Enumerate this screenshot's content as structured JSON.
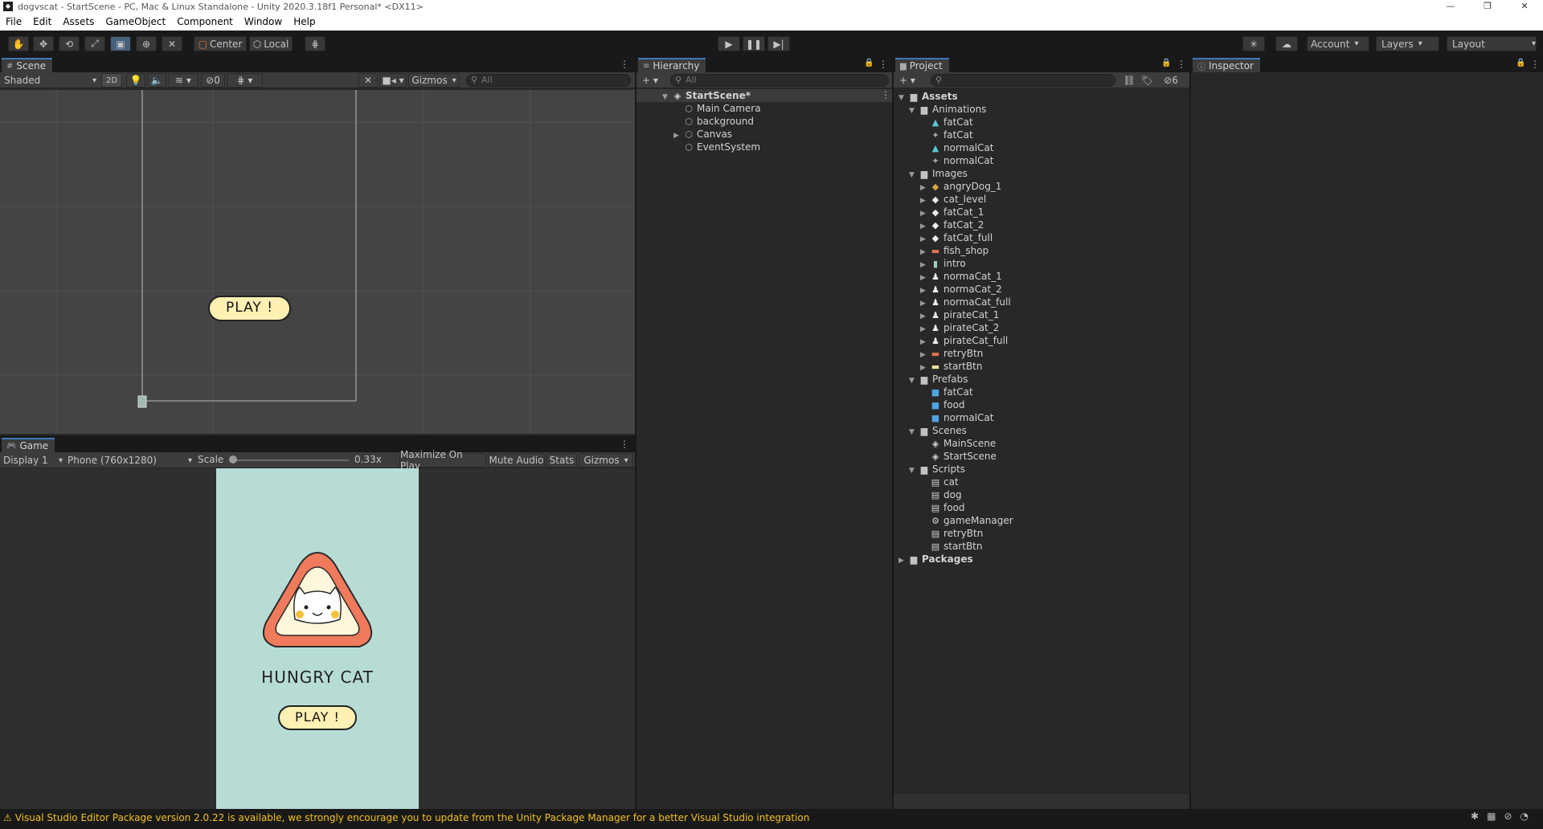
{
  "window": {
    "title": "dogvscat - StartScene - PC, Mac & Linux Standalone - Unity 2020.3.18f1 Personal* <DX11>",
    "controls": [
      "—",
      "❐",
      "✕"
    ]
  },
  "menu": [
    "File",
    "Edit",
    "Assets",
    "GameObject",
    "Component",
    "Window",
    "Help"
  ],
  "toolbar": {
    "pivot": "Center",
    "space": "Local",
    "account": "Account",
    "layers": "Layers",
    "layout": "Layout"
  },
  "scene": {
    "tab": "Scene",
    "shading": "Shaded",
    "mode_2d": "2D",
    "hidden_count": "0",
    "gizmos": "Gizmos",
    "search_placeholder": "All",
    "play_button_label": "PLAY !"
  },
  "game": {
    "tab": "Game",
    "display": "Display 1",
    "resolution": "Phone (760x1280)",
    "scale_label": "Scale",
    "scale_value": "0.33x",
    "scale_fraction": 0.0,
    "maximize": "Maximize On Play",
    "mute": "Mute Audio",
    "stats": "Stats",
    "gizmos": "Gizmos",
    "title": "HUNGRY CAT",
    "play_label": "PLAY !",
    "bg_color": "#b7dcd5"
  },
  "hierarchy": {
    "tab": "Hierarchy",
    "search_placeholder": "All",
    "scene_name": "StartScene*",
    "items": [
      "Main Camera",
      "background",
      "Canvas",
      "EventSystem"
    ]
  },
  "project": {
    "tab": "Project",
    "hidden_count": "6",
    "root": "Assets",
    "folders": {
      "animations": "Animations",
      "images": "Images",
      "prefabs": "Prefabs",
      "scenes": "Scenes",
      "scripts": "Scripts",
      "packages": "Packages"
    },
    "animations": [
      "fatCat",
      "fatCat",
      "normalCat",
      "normalCat"
    ],
    "images": [
      "angryDog_1",
      "cat_level",
      "fatCat_1",
      "fatCat_2",
      "fatCat_full",
      "fish_shop",
      "intro",
      "normaCat_1",
      "normaCat_2",
      "normaCat_full",
      "pirateCat_1",
      "pirateCat_2",
      "pirateCat_full",
      "retryBtn",
      "startBtn"
    ],
    "prefabs": [
      "fatCat",
      "food",
      "normalCat"
    ],
    "scenes": [
      "MainScene",
      "StartScene"
    ],
    "scripts": [
      "cat",
      "dog",
      "food",
      "gameManager",
      "retryBtn",
      "startBtn"
    ]
  },
  "inspector": {
    "tab": "Inspector"
  },
  "status": {
    "message": "Visual Studio Editor Package version 2.0.22 is available, we strongly encourage you to update from the Unity Package Manager for a better Visual Studio integration"
  },
  "colors": {
    "accent": "#3a79bb",
    "warning": "#f3c21d",
    "button_fill": "#fff0b3",
    "cat_triangle": "#f07a5c"
  }
}
